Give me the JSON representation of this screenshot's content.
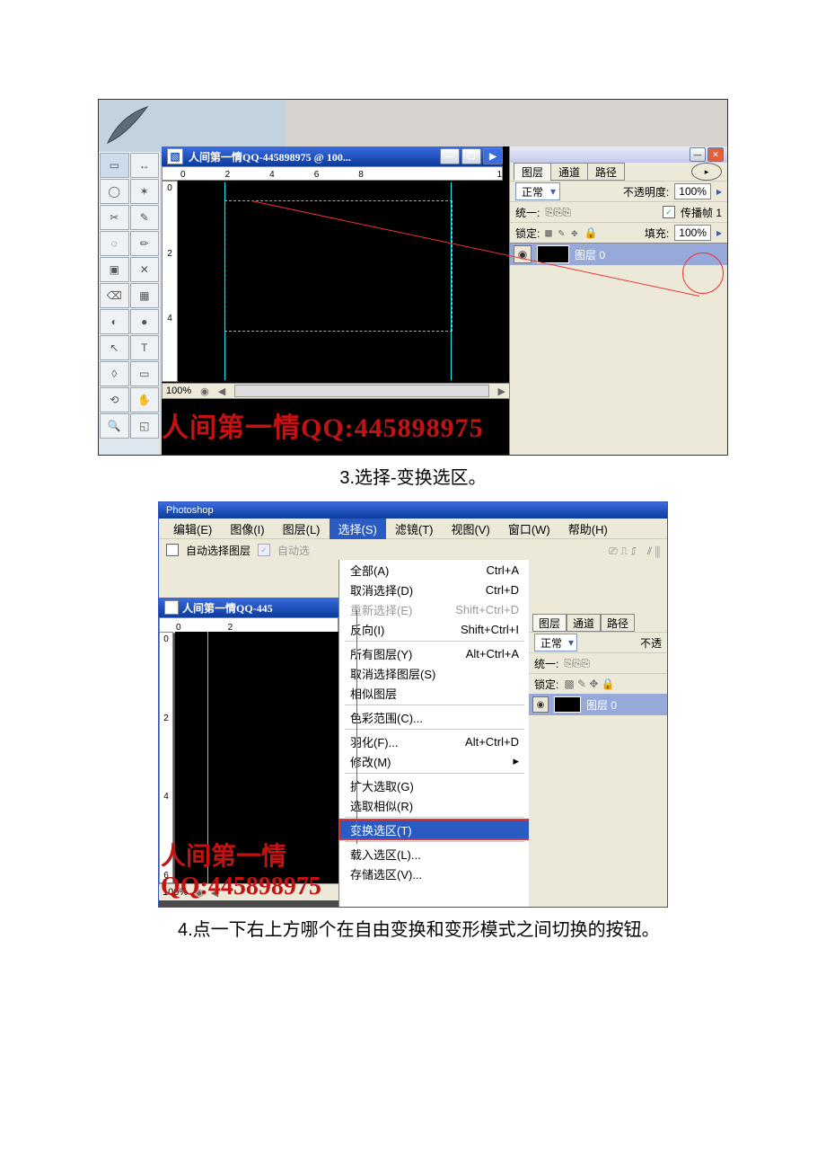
{
  "fig1": {
    "docTitle": "人间第一情QQ-445898975 @ 100...",
    "ruler": [
      "0",
      "2",
      "4",
      "6",
      "8"
    ],
    "rulerEnd": "1",
    "rulerV": [
      "0",
      "2",
      "4"
    ],
    "zoom": "100%",
    "watermark": "人间第一情QQ:445898975",
    "tools": [
      "▭",
      "↔",
      "◯",
      "✶",
      "✂",
      "✎",
      "◌",
      "✏",
      "▣",
      "✕",
      "⌫",
      "▦",
      "◐",
      "●",
      "↖",
      "T",
      "◊",
      "▭",
      "⟲",
      "✋",
      "🔍",
      "◱"
    ],
    "panel": {
      "tabs": {
        "layer": "图层",
        "channel": "通道",
        "path": "路径"
      },
      "blendLabel": "正常",
      "opacityLabel": "不透明度:",
      "opacity": "100%",
      "unifyLabel": "统一:",
      "propagateLabel": "传播帧 1",
      "lockLabel": "锁定:",
      "fillLabel": "填充:",
      "fill": "100%",
      "layer0": "图层 0"
    }
  },
  "caption1": "3.选择-变换选区。",
  "fig2": {
    "topbar": "Photoshop",
    "menus": [
      "编辑(E)",
      "图像(I)",
      "图层(L)",
      "选择(S)",
      "滤镜(T)",
      "视图(V)",
      "窗口(W)",
      "帮助(H)"
    ],
    "opts": {
      "auto": "自动选择图层",
      "auto2": "自动选"
    },
    "doc": {
      "title": "人间第一情QQ-445",
      "ruler": [
        "0",
        "2"
      ],
      "rv": [
        "0",
        "2",
        "4",
        "6"
      ],
      "zoom": "100%"
    },
    "watermark": "人间第一情QQ:445898975",
    "menu": [
      {
        "l": "全部(A)",
        "r": "Ctrl+A"
      },
      {
        "l": "取消选择(D)",
        "r": "Ctrl+D"
      },
      {
        "l": "重新选择(E)",
        "r": "Shift+Ctrl+D",
        "dis": true
      },
      {
        "l": "反向(I)",
        "r": "Shift+Ctrl+I"
      },
      {
        "hr": true
      },
      {
        "l": "所有图层(Y)",
        "r": "Alt+Ctrl+A"
      },
      {
        "l": "取消选择图层(S)",
        "r": ""
      },
      {
        "l": "相似图层",
        "r": ""
      },
      {
        "hr": true
      },
      {
        "l": "色彩范围(C)...",
        "r": ""
      },
      {
        "hr": true
      },
      {
        "l": "羽化(F)...",
        "r": "Alt+Ctrl+D"
      },
      {
        "l": "修改(M)",
        "r": "▸"
      },
      {
        "hr": true
      },
      {
        "l": "扩大选取(G)",
        "r": ""
      },
      {
        "l": "选取相似(R)",
        "r": ""
      },
      {
        "hr": true
      },
      {
        "l": "变换选区(T)",
        "r": "",
        "hi": true,
        "box": true
      },
      {
        "hr": true
      },
      {
        "l": "载入选区(L)...",
        "r": ""
      },
      {
        "l": "存储选区(V)...",
        "r": ""
      }
    ],
    "panel": {
      "tabs": {
        "layer": "图层",
        "channel": "通道",
        "path": "路径"
      },
      "blendLabel": "正常",
      "opacityLabel": "不透",
      "unifyLabel": "统一:",
      "lockLabel": "锁定:",
      "layer0": "图层 0"
    }
  },
  "caption2": "4.点一下右上方哪个在自由变换和变形模式之间切换的按钮。"
}
